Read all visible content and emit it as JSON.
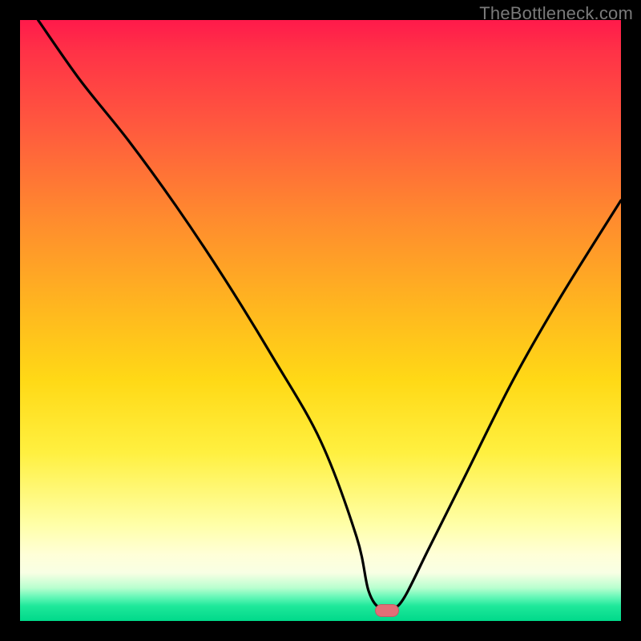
{
  "watermark": "TheBottleneck.com",
  "chart_data": {
    "type": "line",
    "title": "",
    "xlabel": "",
    "ylabel": "",
    "xlim": [
      0,
      100
    ],
    "ylim": [
      0,
      100
    ],
    "grid": false,
    "series": [
      {
        "name": "bottleneck-curve",
        "x": [
          3,
          10,
          18,
          26,
          34,
          42,
          50,
          56,
          58,
          60,
          62,
          64,
          68,
          74,
          82,
          90,
          100
        ],
        "values": [
          100,
          90,
          80,
          69,
          57,
          44,
          30,
          14,
          5,
          2,
          2,
          4,
          12,
          24,
          40,
          54,
          70
        ]
      }
    ],
    "marker_x": 61,
    "gradient_stops": [
      {
        "pos": 0,
        "color": "#ff1a4b"
      },
      {
        "pos": 0.18,
        "color": "#ff5a3e"
      },
      {
        "pos": 0.48,
        "color": "#ffb71f"
      },
      {
        "pos": 0.72,
        "color": "#fff040"
      },
      {
        "pos": 0.92,
        "color": "#f8ffe4"
      },
      {
        "pos": 1.0,
        "color": "#00d98a"
      }
    ]
  }
}
